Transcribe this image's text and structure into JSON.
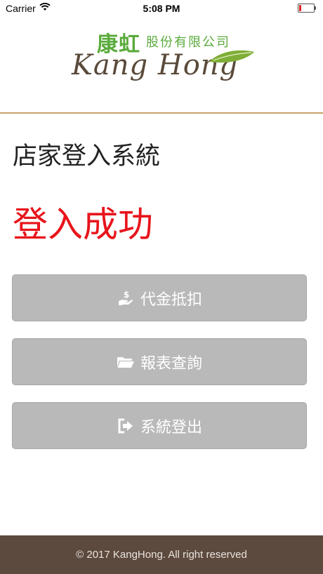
{
  "status_bar": {
    "carrier": "Carrier",
    "time": "5:08 PM",
    "battery_level": 0.15,
    "battery_color": "#e02020"
  },
  "logo": {
    "chinese_main": "康虹",
    "chinese_sub": "股份有限公司",
    "english": "Kang Hong"
  },
  "page": {
    "title": "店家登入系統",
    "success": "登入成功"
  },
  "buttons": [
    {
      "label": "代金抵扣",
      "icon": "hand-dollar-icon"
    },
    {
      "label": "報表查詢",
      "icon": "folder-open-icon"
    },
    {
      "label": "系統登出",
      "icon": "sign-out-icon"
    }
  ],
  "footer": {
    "text": "© 2017 KangHong. All right reserved"
  },
  "colors": {
    "accent_line": "#c8a36a",
    "success": "#e8141b",
    "button_bg": "#b9b9b9",
    "footer_bg": "#5d4a3f",
    "logo_green": "#5aab3c"
  }
}
